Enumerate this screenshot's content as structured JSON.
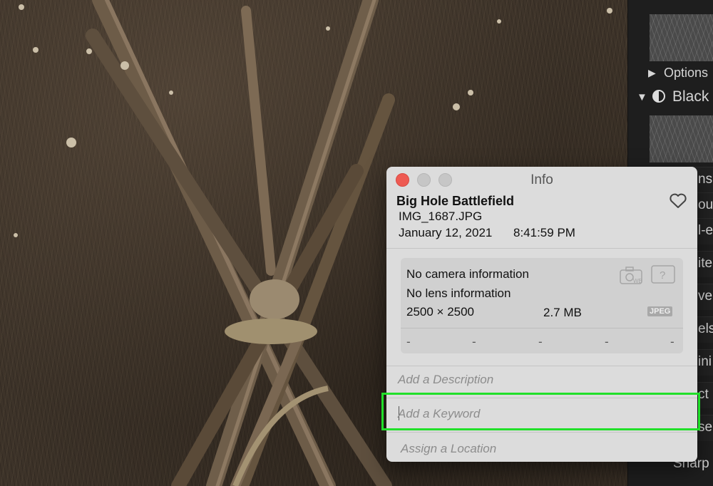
{
  "sidebar": {
    "options_label": "Options",
    "section_label": "Black",
    "bottom_label": "Sharp",
    "truncated_items": [
      "ns",
      "ou",
      "l-e",
      "ite",
      "ve",
      "els",
      "ini",
      "ct",
      "se"
    ]
  },
  "info_panel": {
    "window_title": "Info",
    "photo_title": "Big Hole Battlefield",
    "filename": "IMG_1687.JPG",
    "date": "January 12, 2021",
    "time": "8:41:59 PM",
    "camera_info": "No camera information",
    "lens_info": "No lens information",
    "dimensions": "2500 × 2500",
    "file_size": "2.7 MB",
    "format_badge": "JPEG",
    "exif_placeholders": [
      "-",
      "-",
      "-",
      "-",
      "-"
    ],
    "description_placeholder": "Add a Description",
    "keyword_placeholder": "Add a Keyword",
    "location_placeholder": "Assign a Location"
  },
  "colors": {
    "highlight": "#21e02a",
    "close_button": "#ee5a52",
    "panel_background": "#dcdcdc"
  }
}
